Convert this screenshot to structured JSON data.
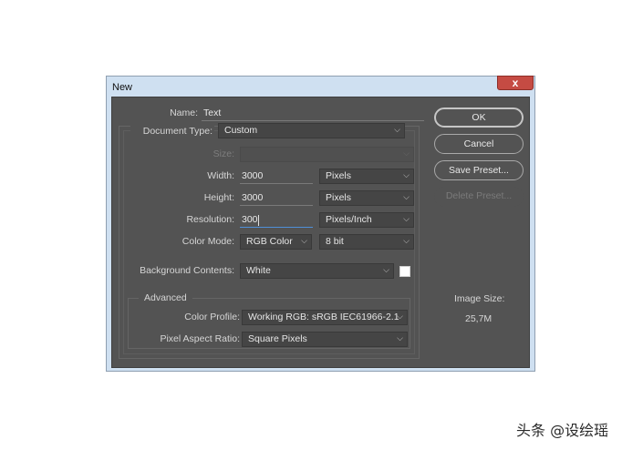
{
  "dialog": {
    "title": "New",
    "close_glyph": "x",
    "name_label": "Name:",
    "name_value": "Text",
    "document_type_label": "Document Type:",
    "document_type_value": "Custom",
    "size_label": "Size:",
    "size_value": "",
    "width_label": "Width:",
    "width_value": "3000",
    "width_unit": "Pixels",
    "height_label": "Height:",
    "height_value": "3000",
    "height_unit": "Pixels",
    "resolution_label": "Resolution:",
    "resolution_value": "300",
    "resolution_unit": "Pixels/Inch",
    "color_mode_label": "Color Mode:",
    "color_mode_value": "RGB Color",
    "bit_depth_value": "8 bit",
    "background_label": "Background Contents:",
    "background_value": "White",
    "background_swatch_color": "#ffffff",
    "advanced_label": "Advanced",
    "color_profile_label": "Color Profile:",
    "color_profile_value": "Working RGB:  sRGB IEC61966-2.1",
    "pixel_aspect_label": "Pixel Aspect Ratio:",
    "pixel_aspect_value": "Square Pixels",
    "chevron_glyph": "⌵"
  },
  "buttons": {
    "ok": "OK",
    "cancel": "Cancel",
    "save_preset": "Save Preset...",
    "delete_preset": "Delete Preset..."
  },
  "image_size": {
    "label": "Image Size:",
    "value": "25,7M"
  },
  "watermark": "头条 @设绘瑶"
}
